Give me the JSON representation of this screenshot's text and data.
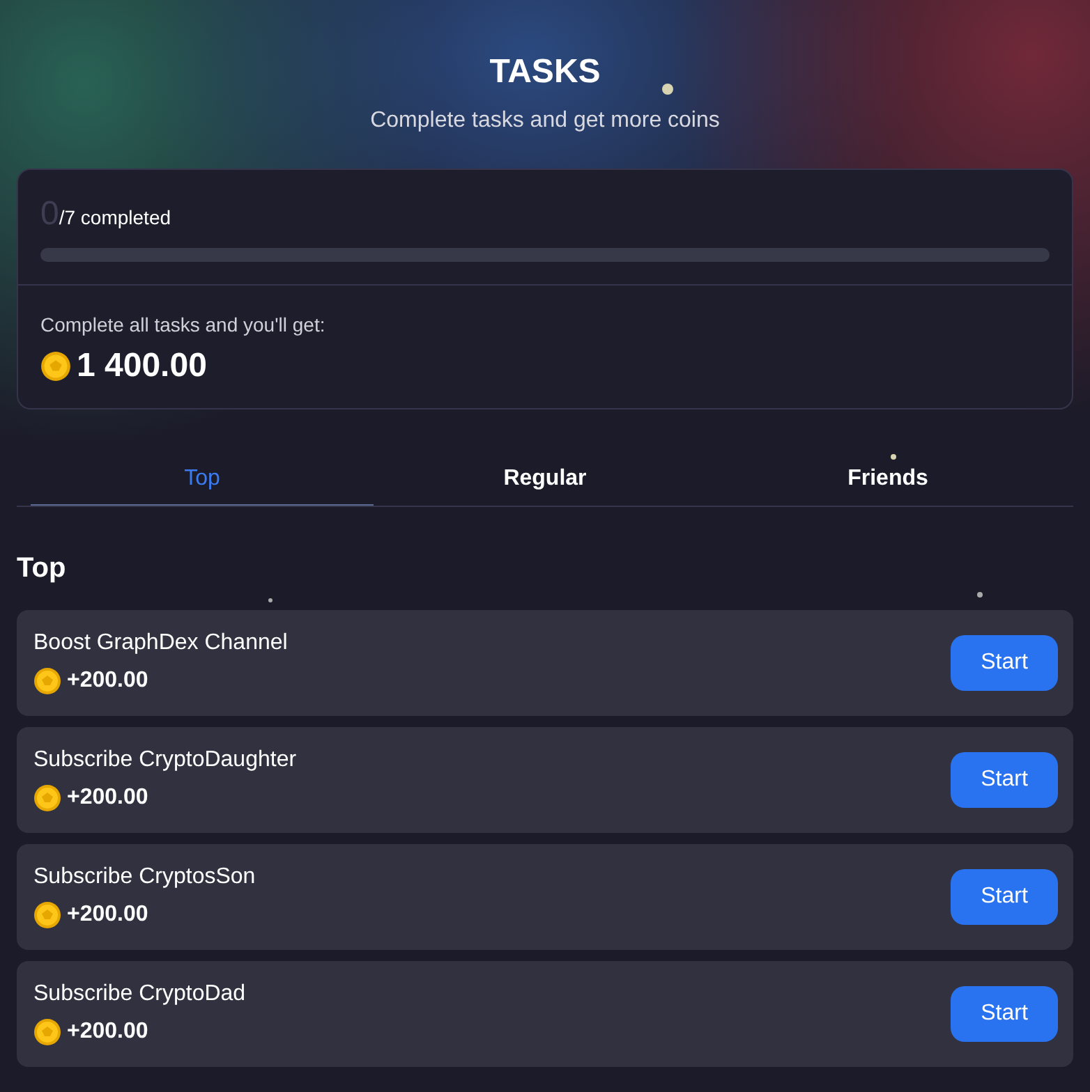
{
  "header": {
    "title": "TASKS",
    "subtitle": "Complete tasks and get more coins"
  },
  "progress": {
    "done": "0",
    "total": "/7 completed",
    "level": 0,
    "reward_label": "Complete all tasks and you'll get:",
    "reward": "1 400.00"
  },
  "tabs": [
    {
      "label": "Top",
      "selected": true
    },
    {
      "label": "Regular",
      "selected": false
    },
    {
      "label": "Friends",
      "selected": false
    }
  ],
  "section_title": "Top",
  "tasks": [
    {
      "title": "Boost GraphDex Channel",
      "reward": "+200.00",
      "button": "Start"
    },
    {
      "title": "Subscribe CryptoDaughter",
      "reward": "+200.00",
      "button": "Start"
    },
    {
      "title": "Subscribe CryptosSon",
      "reward": "+200.00",
      "button": "Start"
    },
    {
      "title": "Subscribe CryptoDad",
      "reward": "+200.00",
      "button": "Start"
    }
  ]
}
